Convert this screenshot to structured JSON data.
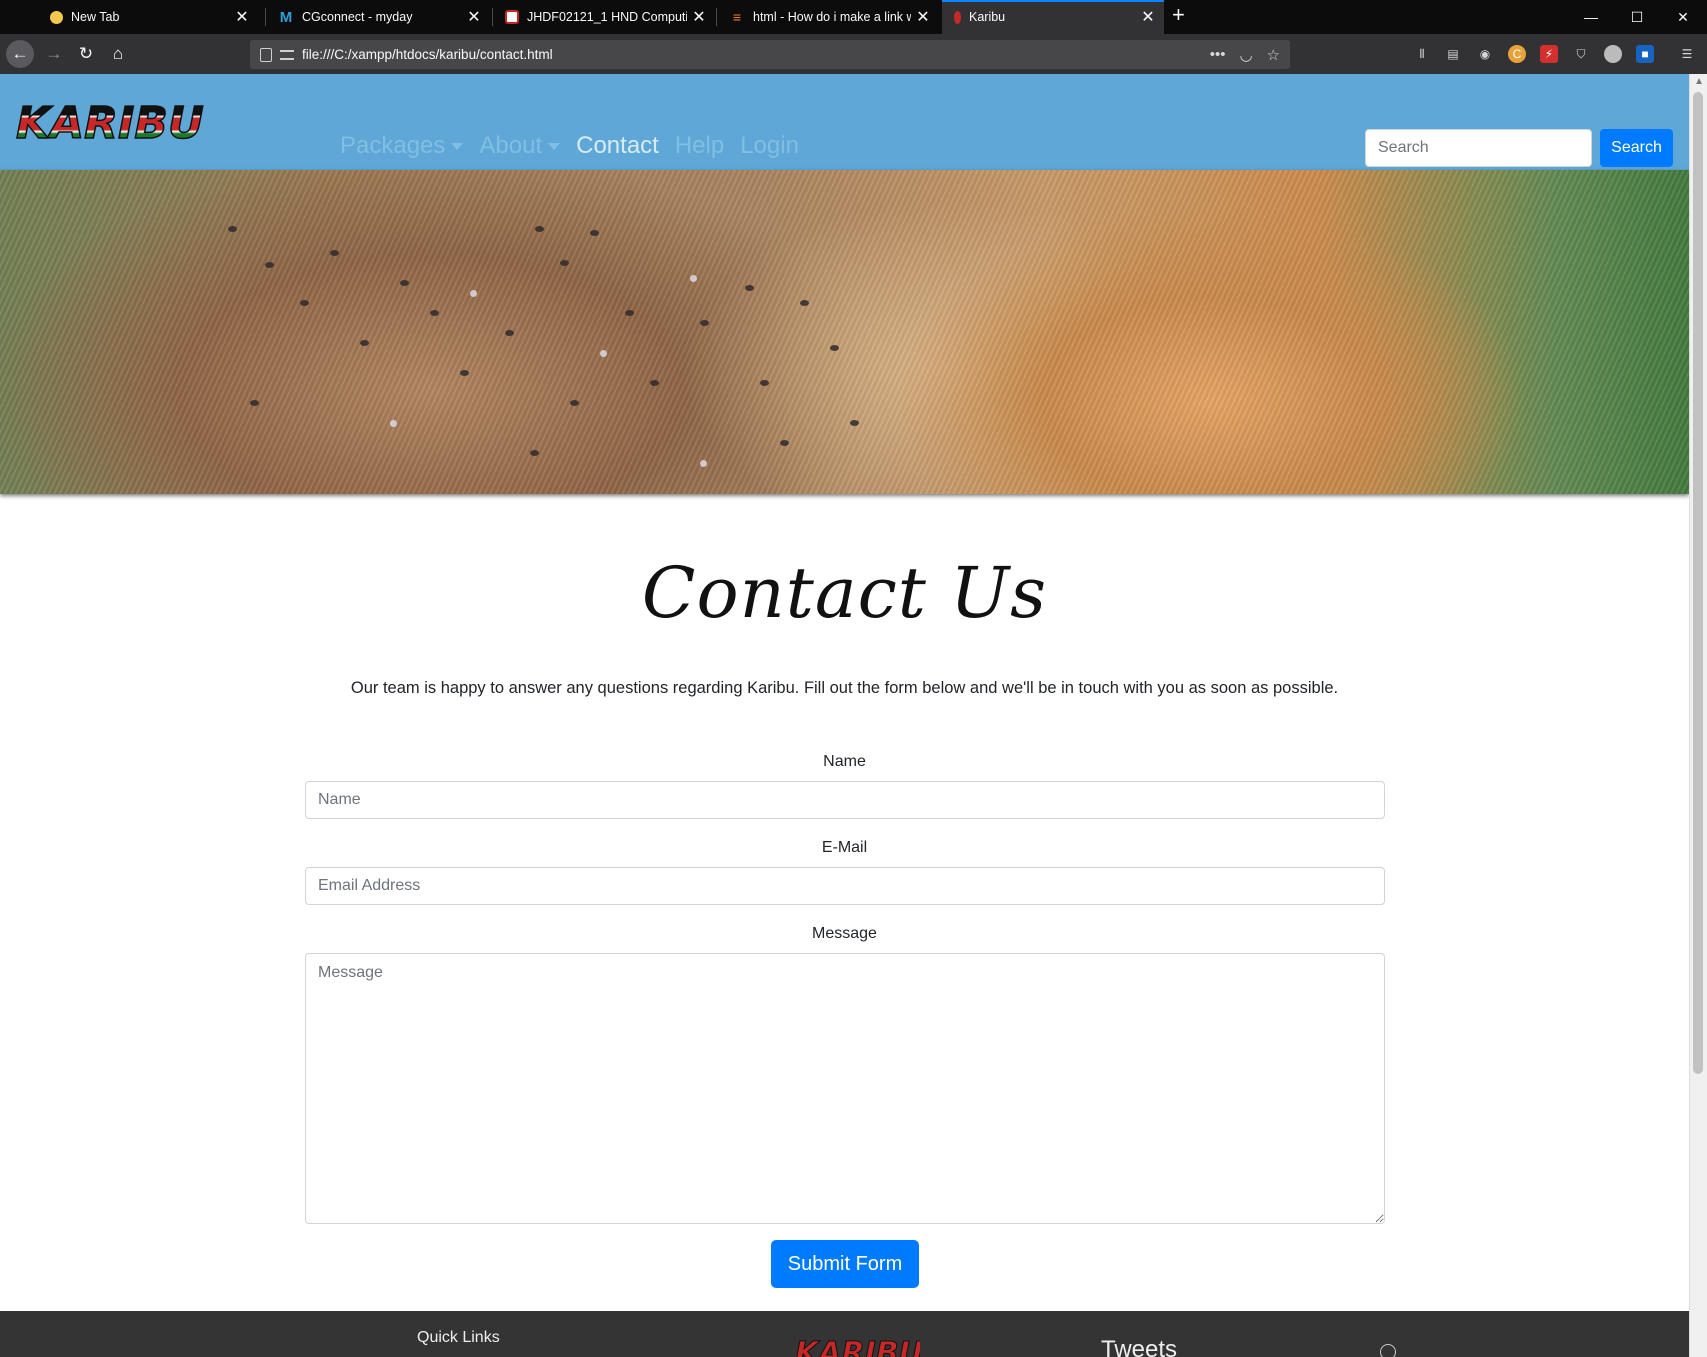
{
  "browser": {
    "tabs": [
      {
        "title": "New Tab"
      },
      {
        "title": "CGconnect - myday"
      },
      {
        "title": "JHDF02121_1 HND Computing"
      },
      {
        "title": "html - How do i make a link wh"
      },
      {
        "title": "Karibu"
      }
    ],
    "url": "file:///C:/xampp/htdocs/karibu/contact.html"
  },
  "site": {
    "logo_text": "KARIBU",
    "nav": [
      {
        "label": "Packages",
        "dropdown": true
      },
      {
        "label": "About",
        "dropdown": true
      },
      {
        "label": "Contact",
        "dropdown": false
      },
      {
        "label": "Help",
        "dropdown": false
      },
      {
        "label": "Login",
        "dropdown": false
      }
    ],
    "search": {
      "placeholder": "Search",
      "button_label": "Search"
    }
  },
  "contact": {
    "title": "Contact Us",
    "lead": "Our team is happy to answer any questions regarding Karibu. Fill out the form below and we'll be in touch with you as soon as possible.",
    "name_label": "Name",
    "name_placeholder": "Name",
    "email_label": "E-Mail",
    "email_placeholder": "Email Address",
    "message_label": "Message",
    "message_placeholder": "Message",
    "submit_label": "Submit Form"
  },
  "footer": {
    "quick_links": "Quick Links",
    "tweets": "Tweets"
  },
  "colors": {
    "header_bg": "#5ea7d6",
    "primary": "#007bff",
    "footer_bg": "#343434"
  }
}
